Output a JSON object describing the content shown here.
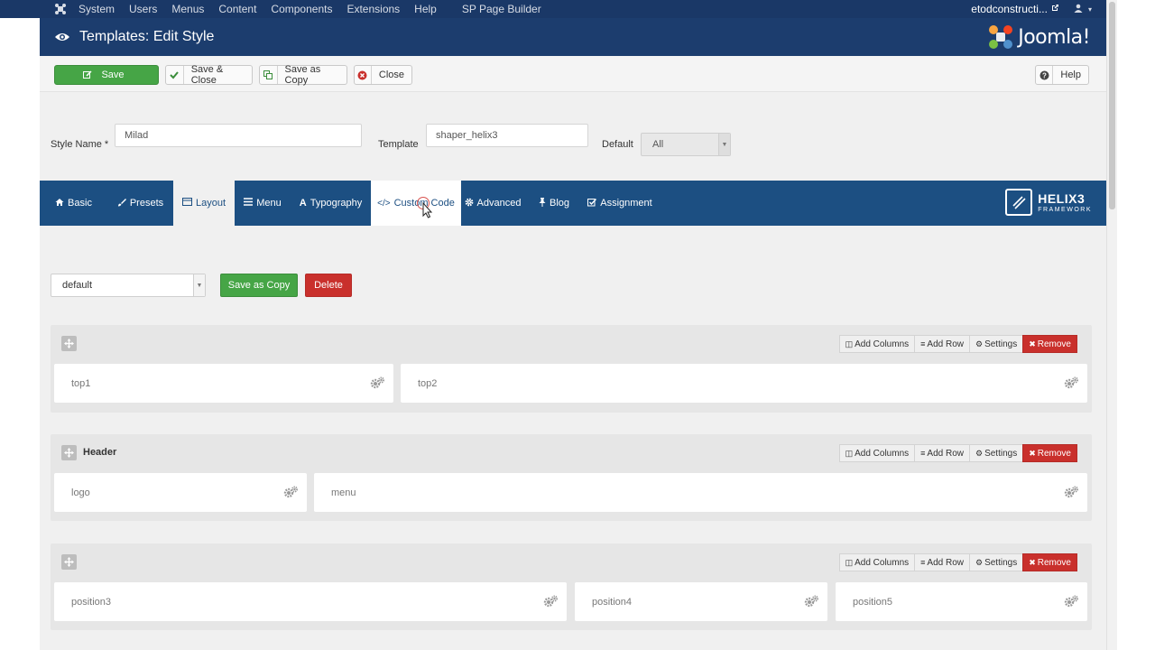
{
  "topbar": {
    "menu": [
      "System",
      "Users",
      "Menus",
      "Content",
      "Components",
      "Extensions",
      "Help",
      "SP Page Builder"
    ],
    "site_name": "etodconstructi...",
    "icons": [
      "joomla-icon",
      "external-link-icon",
      "user-icon",
      "caret-down-icon"
    ]
  },
  "header": {
    "title": "Templates: Edit Style",
    "brand": "Joomla!",
    "icons": [
      "eye-icon",
      "joomla-logo"
    ]
  },
  "toolbar": {
    "save_label": "Save",
    "save_close_label": "Save & Close",
    "save_copy_label": "Save as Copy",
    "close_label": "Close",
    "help_label": "Help"
  },
  "form": {
    "style_name_label": "Style Name *",
    "style_name_value": "Milad",
    "template_label": "Template",
    "template_value": "shaper_helix3",
    "default_label": "Default",
    "default_value": "All"
  },
  "tabs": [
    {
      "label": "Basic",
      "icon": "home-icon"
    },
    {
      "label": "Presets",
      "icon": "brush-icon"
    },
    {
      "label": "Layout",
      "icon": "layout-icon"
    },
    {
      "label": "Menu",
      "icon": "list-icon"
    },
    {
      "label": "Typography",
      "icon": "font-icon"
    },
    {
      "label": "Custom Code",
      "icon": "code-icon"
    },
    {
      "label": "Advanced",
      "icon": "gear-icon"
    },
    {
      "label": "Blog",
      "icon": "pin-icon"
    },
    {
      "label": "Assignment",
      "icon": "check-square-icon"
    }
  ],
  "helix": {
    "name": "HELIX3",
    "sub": "FRAMEWORK"
  },
  "layout_controls": {
    "selected_layout": "default",
    "save_copy_label": "Save as Copy",
    "delete_label": "Delete"
  },
  "row_tools": {
    "add_columns": "Add Columns",
    "add_row": "Add Row",
    "settings": "Settings",
    "remove": "Remove"
  },
  "rows": [
    {
      "title": "",
      "columns": [
        "top1",
        "top2"
      ]
    },
    {
      "title": "Header",
      "columns": [
        "logo",
        "menu"
      ]
    },
    {
      "title": "",
      "columns": [
        "position3",
        "position4",
        "position5"
      ]
    }
  ],
  "colors": {
    "topbar": "#1a3867",
    "header": "#1c3d6e",
    "tabs": "#1c4f82",
    "save": "#46a546",
    "remove": "#c9302c"
  }
}
